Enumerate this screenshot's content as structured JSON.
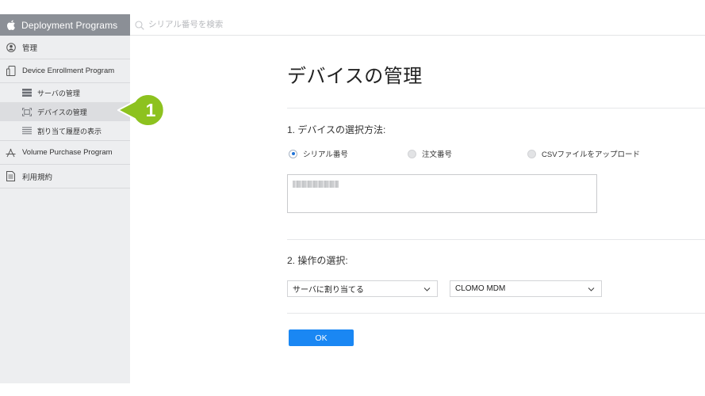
{
  "sidebar": {
    "header_title": "Deployment Programs",
    "items": [
      {
        "label": "管理",
        "icon": "user-circle-icon"
      },
      {
        "label": "Device Enrollment Program",
        "icon": "device-icon"
      },
      {
        "label": "Volume Purchase Program",
        "icon": "app-store-icon"
      },
      {
        "label": "利用規約",
        "icon": "document-icon"
      }
    ],
    "dep_subitems": [
      {
        "label": "サーバの管理",
        "icon": "server-icon"
      },
      {
        "label": "デバイスの管理",
        "icon": "device-frame-icon",
        "active": true
      },
      {
        "label": "割り当て履歴の表示",
        "icon": "list-icon"
      }
    ]
  },
  "search": {
    "placeholder": "シリアル番号を検索"
  },
  "main": {
    "title": "デバイスの管理",
    "step1_label": "1. デバイスの選択方法:",
    "radio_options": [
      {
        "label": "シリアル番号",
        "selected": true
      },
      {
        "label": "注文番号",
        "selected": false
      },
      {
        "label": "CSVファイルをアップロード",
        "selected": false
      }
    ],
    "step2_label": "2. 操作の選択:",
    "action_select": {
      "value": "サーバに割り当てる"
    },
    "server_select": {
      "value": "CLOMO MDM"
    },
    "ok_label": "OK"
  },
  "annotation": {
    "number": "1",
    "color": "#8dc21f"
  },
  "colors": {
    "accent": "#1a87f3",
    "sidebar_header": "#8b8f96",
    "sidebar_bg": "#edeef0"
  }
}
